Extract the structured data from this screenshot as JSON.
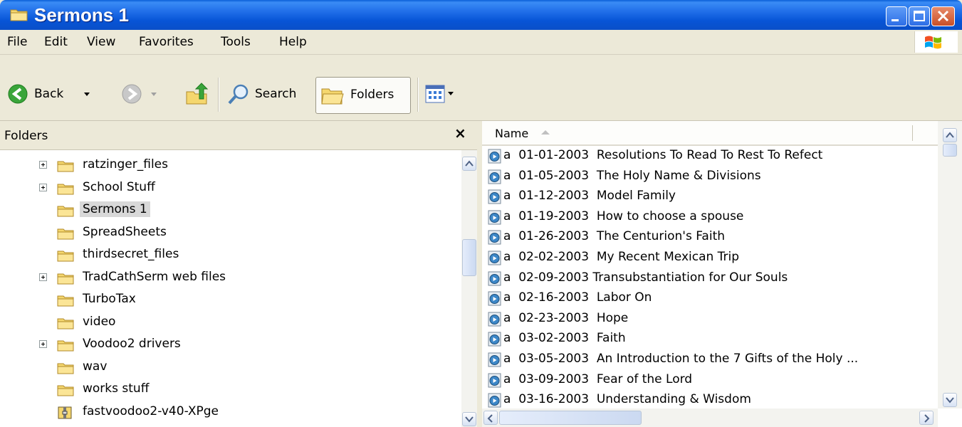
{
  "window": {
    "title": "Sermons 1",
    "accent": "#0a5fd7"
  },
  "menu": [
    "File",
    "Edit",
    "View",
    "Favorites",
    "Tools",
    "Help"
  ],
  "toolbar": {
    "back_label": "Back",
    "search_label": "Search",
    "folders_label": "Folders"
  },
  "folders_pane": {
    "title": "Folders",
    "close_glyph": "×",
    "items": [
      {
        "label": "ratzinger_files",
        "expandable": true,
        "selected": false
      },
      {
        "label": "School Stuff",
        "expandable": true,
        "selected": false
      },
      {
        "label": "Sermons 1",
        "expandable": false,
        "selected": true
      },
      {
        "label": "SpreadSheets",
        "expandable": false,
        "selected": false
      },
      {
        "label": "thirdsecret_files",
        "expandable": false,
        "selected": false
      },
      {
        "label": "TradCathSerm web files",
        "expandable": true,
        "selected": false
      },
      {
        "label": "TurboTax",
        "expandable": false,
        "selected": false
      },
      {
        "label": "video",
        "expandable": false,
        "selected": false
      },
      {
        "label": "Voodoo2 drivers",
        "expandable": true,
        "selected": false
      },
      {
        "label": "wav",
        "expandable": false,
        "selected": false
      },
      {
        "label": "works stuff",
        "expandable": false,
        "selected": false
      },
      {
        "label": "fastvoodoo2-v40-XPge",
        "expandable": false,
        "selected": false,
        "icon": "archive-icon"
      }
    ]
  },
  "file_list": {
    "column_name": "Name",
    "files": [
      "a  01-01-2003  Resolutions To Read To Rest To Refect",
      "a  01-05-2003  The Holy Name & Divisions",
      "a  01-12-2003  Model Family",
      "a  01-19-2003  How to choose a spouse",
      "a  01-26-2003  The Centurion's Faith",
      "a  02-02-2003  My Recent Mexican Trip",
      "a  02-09-2003 Transubstantiation for Our Souls",
      "a  02-16-2003  Labor On",
      "a  02-23-2003  Hope",
      "a  03-02-2003  Faith",
      "a  03-05-2003  An Introduction to the 7 Gifts of the Holy ...",
      "a  03-09-2003  Fear of the Lord",
      "a  03-16-2003  Understanding & Wisdom"
    ]
  }
}
